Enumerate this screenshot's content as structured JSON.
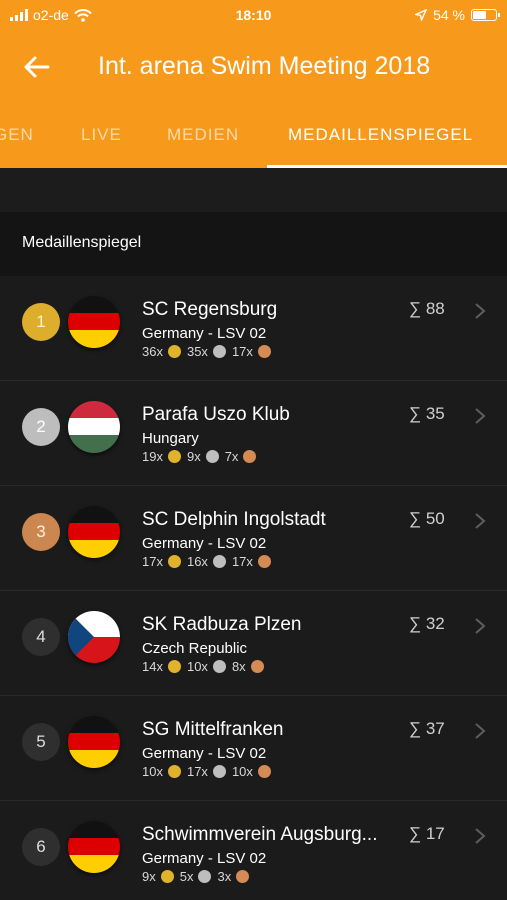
{
  "status_bar": {
    "carrier": "o2-de",
    "time": "18:10",
    "battery": "54 %",
    "battery_level": 0.54,
    "wifi_icon": "wifi-icon",
    "location_icon": "location-arrow-icon"
  },
  "header": {
    "title": "Int. arena Swim Meeting 2018",
    "back_icon": "arrow-left-icon"
  },
  "tabs": [
    {
      "label": "GEN"
    },
    {
      "label": "LIVE"
    },
    {
      "label": "MEDIEN"
    },
    {
      "label": "MEDAILLENSPIEGEL",
      "active": true
    }
  ],
  "section": {
    "title": "Medaillenspiegel"
  },
  "colors": {
    "accent": "#f79a1c",
    "gold": "#e1b22c",
    "silver": "#bebebe",
    "bronze": "#d68a54",
    "background": "#1b1b1b"
  },
  "rows": [
    {
      "rank": "1",
      "club": "SC Regensburg",
      "sub": "Germany - LSV 02",
      "gold": "36x",
      "silver": "35x",
      "bronze": "17x",
      "total": "∑ 88",
      "flag": "germany-flag-icon"
    },
    {
      "rank": "2",
      "club": "Parafa Uszo Klub",
      "sub": "Hungary",
      "gold": "19x",
      "silver": "9x",
      "bronze": "7x",
      "total": "∑ 35",
      "flag": "hungary-flag-icon"
    },
    {
      "rank": "3",
      "club": "SC Delphin Ingolstadt",
      "sub": "Germany - LSV 02",
      "gold": "17x",
      "silver": "16x",
      "bronze": "17x",
      "total": "∑ 50",
      "flag": "germany-flag-icon"
    },
    {
      "rank": "4",
      "club": "SK Radbuza Plzen",
      "sub": "Czech Republic",
      "gold": "14x",
      "silver": "10x",
      "bronze": "8x",
      "total": "∑ 32",
      "flag": "czech-flag-icon"
    },
    {
      "rank": "5",
      "club": "SG Mittelfranken",
      "sub": "Germany - LSV 02",
      "gold": "10x",
      "silver": "17x",
      "bronze": "10x",
      "total": "∑ 37",
      "flag": "germany-flag-icon"
    },
    {
      "rank": "6",
      "club": "Schwimmverein Augsburg...",
      "sub": "Germany - LSV 02",
      "gold": "9x",
      "silver": "5x",
      "bronze": "3x",
      "total": "∑ 17",
      "flag": "germany-flag-icon"
    }
  ]
}
